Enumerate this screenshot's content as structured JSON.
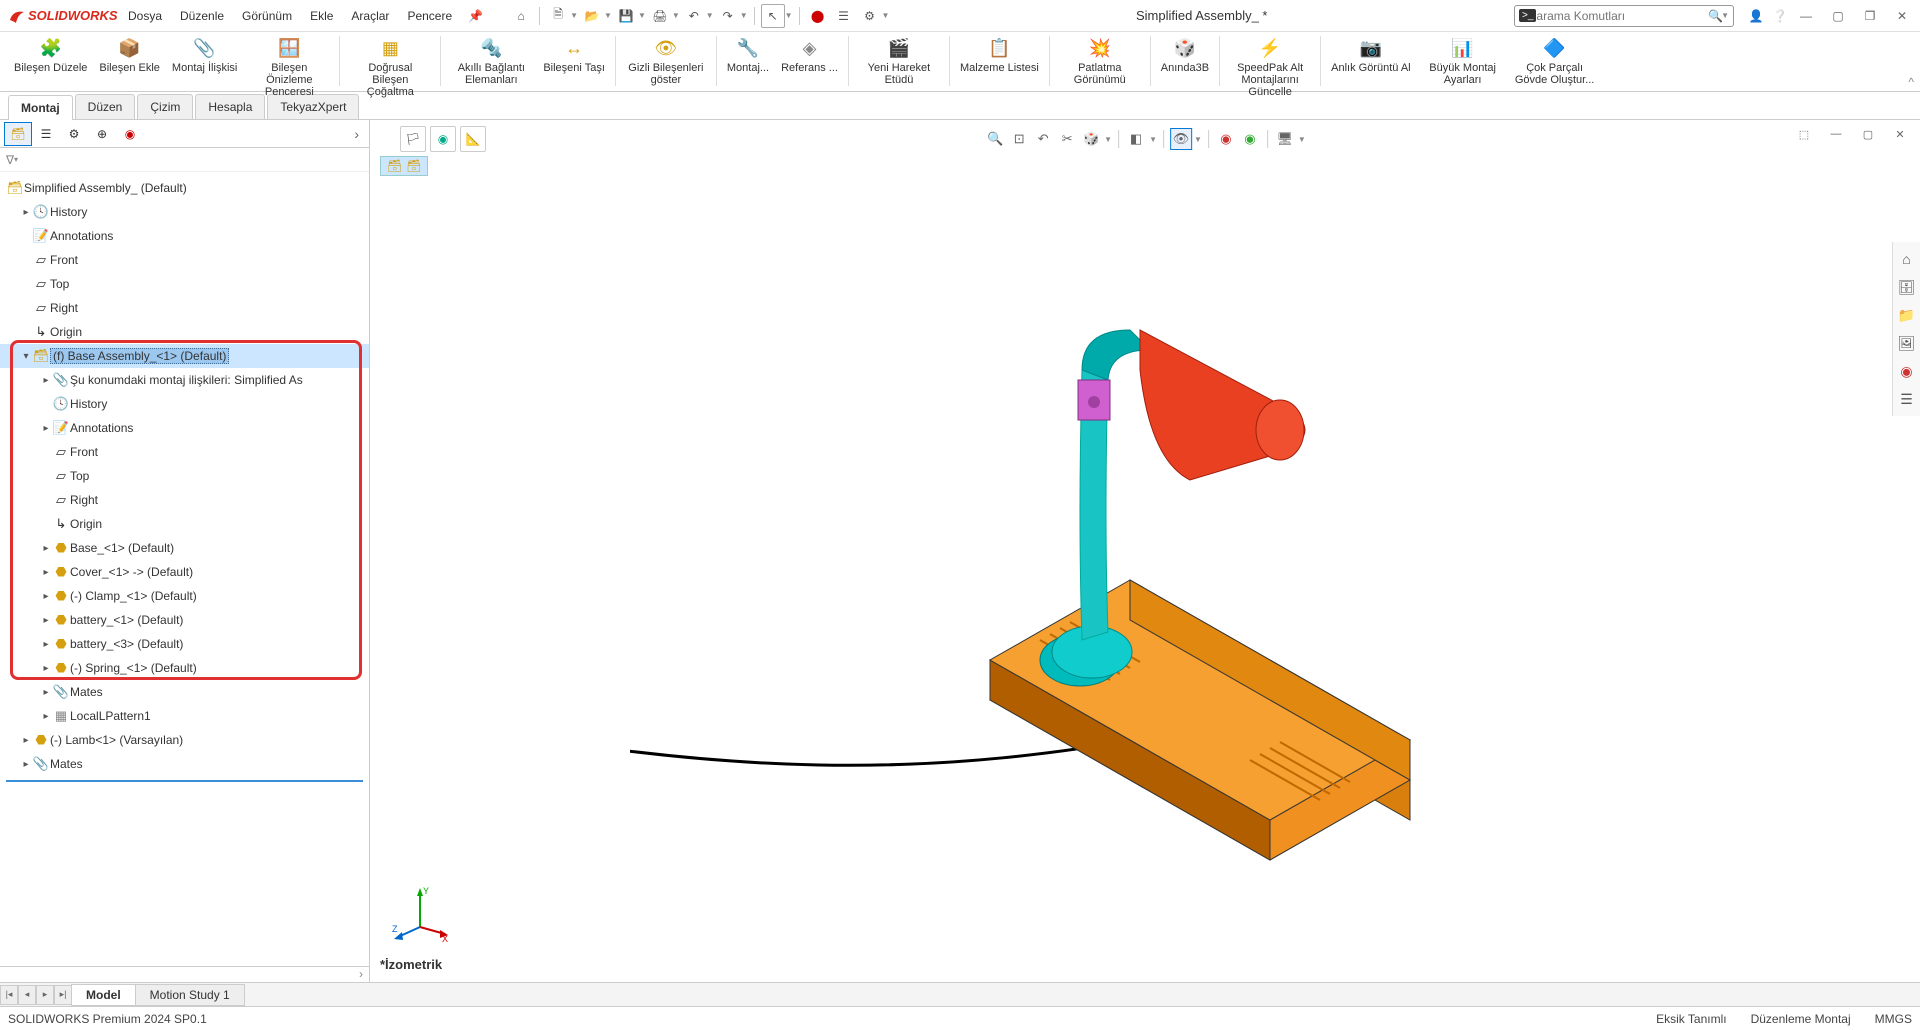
{
  "app": {
    "brand": "SOLIDWORKS",
    "doc_title": "Simplified Assembly_ *"
  },
  "menu": {
    "file": "Dosya",
    "edit": "Düzenle",
    "view": "Görünüm",
    "insert": "Ekle",
    "tools": "Araçlar",
    "window": "Pencere"
  },
  "search": {
    "placeholder": "arama Komutları"
  },
  "ribbon": {
    "items": [
      "Bileşen Düzele",
      "Bileşen Ekle",
      "Montaj İlişkisi",
      "Bileşen Önizleme Penceresi",
      "Doğrusal Bileşen Çoğaltma",
      "Akıllı Bağlantı Elemanları",
      "Bileşeni Taşı",
      "Gizli Bileşenleri göster",
      "Montaj...",
      "Referans ...",
      "Yeni Hareket Etüdü",
      "Malzeme Listesi",
      "Patlatma Görünümü",
      "Anında3B",
      "SpeedPak Alt Montajlarını Güncelle",
      "Anlık Görüntü Al",
      "Büyük Montaj Ayarları",
      "Çok Parçalı Gövde Oluştur..."
    ]
  },
  "cmd_tabs": {
    "assembly": "Montaj",
    "layout": "Düzen",
    "sketch": "Çizim",
    "evaluate": "Hesapla",
    "tekyaz": "TekyazXpert"
  },
  "tree": {
    "root": "Simplified Assembly_ (Default)",
    "history": "History",
    "annotations": "Annotations",
    "front": "Front",
    "top": "Top",
    "right": "Right",
    "origin": "Origin",
    "base_asm": "(f) Base Assembly_<1> (Default)",
    "mates_in_pos": "Şu konumdaki montaj ilişkileri: Simplified As",
    "sub_history": "History",
    "sub_annotations": "Annotations",
    "sub_front": "Front",
    "sub_top": "Top",
    "sub_right": "Right",
    "sub_origin": "Origin",
    "base": "Base_<1> (Default)",
    "cover": "Cover_<1> -> (Default)",
    "clamp": "(-) Clamp_<1> (Default)",
    "battery1": "battery_<1> (Default)",
    "battery3": "battery_<3> (Default)",
    "spring": "(-) Spring_<1> (Default)",
    "mates": "Mates",
    "local_pattern": "LocalLPattern1",
    "lamb": "(-) Lamb<1> (Varsayılan)",
    "mates2": "Mates"
  },
  "viewport": {
    "orientation": "*İzometrik"
  },
  "bottom_tabs": {
    "model": "Model",
    "motion": "Motion Study 1"
  },
  "status": {
    "version": "SOLIDWORKS Premium 2024 SP0.1",
    "under_defined": "Eksik Tanımlı",
    "edit_mode": "Düzenleme Montaj",
    "units": "MMGS"
  }
}
